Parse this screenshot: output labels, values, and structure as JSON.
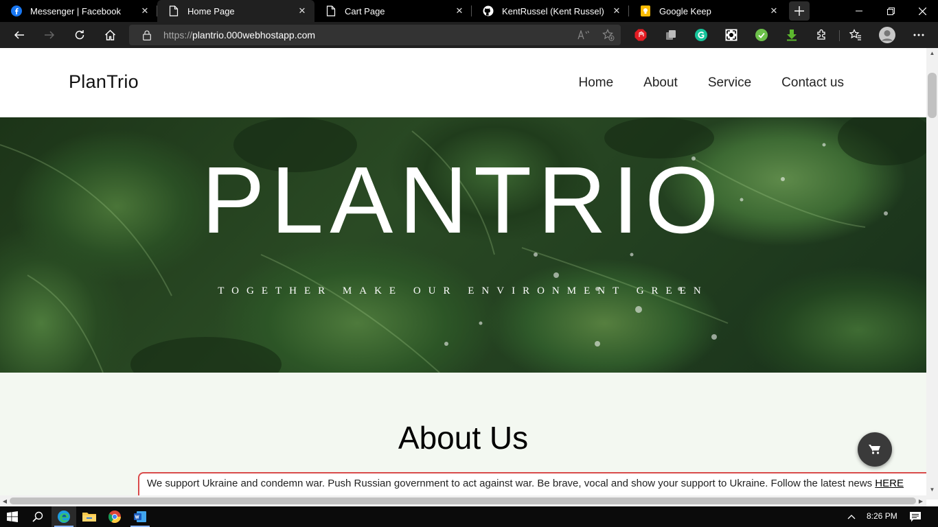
{
  "browser": {
    "tabs": [
      {
        "title": "Messenger | Facebook",
        "icon": "facebook-icon",
        "active": false
      },
      {
        "title": "Home Page",
        "icon": "page-icon",
        "active": true
      },
      {
        "title": "Cart Page",
        "icon": "page-icon",
        "active": false
      },
      {
        "title": "KentRussel (Kent Russel)",
        "icon": "github-icon",
        "active": false
      },
      {
        "title": "Google Keep",
        "icon": "keep-icon",
        "active": false
      }
    ],
    "address": {
      "protocol": "https://",
      "host": "plantrio.000webhostapp.com"
    }
  },
  "site": {
    "logo": "PlanTrio",
    "nav": [
      "Home",
      "About",
      "Service",
      "Contact us"
    ],
    "hero": {
      "title": "PLANTRIO",
      "subtitle": "TOGETHER MAKE OUR ENVIRONMENT GREEN"
    },
    "about_title": "About Us",
    "banner": {
      "text": "We support Ukraine and condemn war. Push Russian government to act against war. Be brave, vocal and show your support to Ukraine. Follow the latest news ",
      "link": "HERE"
    }
  },
  "taskbar": {
    "time": "8:26 PM"
  },
  "colors": {
    "chrome_bg": "#202020",
    "banner_border": "#d94a4a",
    "about_bg": "#f3f8f1"
  }
}
